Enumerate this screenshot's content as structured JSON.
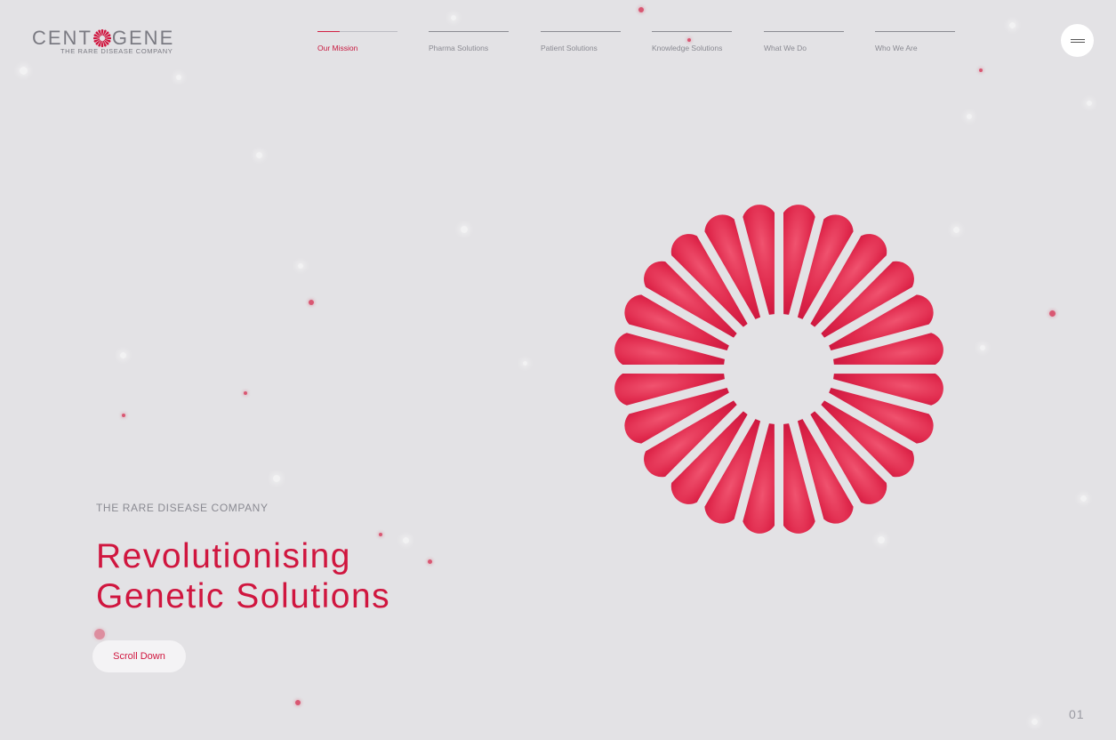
{
  "logo": {
    "word_left": "CENT",
    "word_right": "GENE",
    "tagline": "THE RARE DISEASE COMPANY"
  },
  "nav": {
    "items": [
      {
        "label": "Our Mission",
        "active": true
      },
      {
        "label": "Pharma Solutions",
        "active": false
      },
      {
        "label": "Patient Solutions",
        "active": false
      },
      {
        "label": "Knowledge Solutions",
        "active": false
      },
      {
        "label": "What We Do",
        "active": false
      },
      {
        "label": "Who We Are",
        "active": false
      }
    ]
  },
  "menu": {
    "icon": "hamburger-icon"
  },
  "hero": {
    "eyebrow": "THE RARE DISEASE COMPANY",
    "headline_line1": "Revolutionising",
    "headline_line2": "Genetic Solutions",
    "scroll_label": "Scroll Down",
    "graphic": "sunburst-logo-icon"
  },
  "page_number": "01",
  "colors": {
    "background": "#e3e2e5",
    "accent": "#d0163f",
    "muted_text": "#8a8a92"
  }
}
